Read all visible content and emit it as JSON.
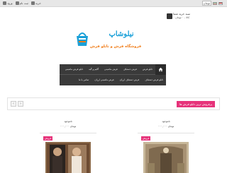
{
  "topbar": {
    "links": [
      "ورود",
      "ثبت نام",
      "خرید"
    ],
    "currency": "تومان",
    "languages": [
      "فارسی",
      "English"
    ]
  },
  "cart": {
    "title": "سبد خرید شما",
    "summary": "۰ کالا - ۰ تومان"
  },
  "logo": {
    "brand": "نیلوشاپ",
    "tagline": "فروشگاه فرش و تابلو فرش"
  },
  "nav": {
    "row1": [
      "تابلو فرش",
      "فرش دستباف",
      "فرش ماشینی",
      "گلیم و گبه",
      "تابلو فرش ماشینی"
    ],
    "row2": [
      "تابلو فرش دستباف",
      "فرش دستباف ارزان",
      "فرش ماشینی ارزان",
      "تماس با ما"
    ]
  },
  "section": {
    "title": "پرفروش ترین تابلو فرش ها"
  },
  "products": [
    {
      "status": "ناموجود",
      "price": "۰۰۰,۰۰۰ تومان",
      "badge": "فروش"
    },
    {
      "status": "ناموجود",
      "price": "۰۰۰,۰۰۰ تومان",
      "badge": "فروش"
    }
  ],
  "colors": {
    "accent": "#e6337a",
    "nav_bg": "#3a3a3a",
    "brand_blue": "#1aa0d8",
    "brand_orange": "#f07a14"
  }
}
